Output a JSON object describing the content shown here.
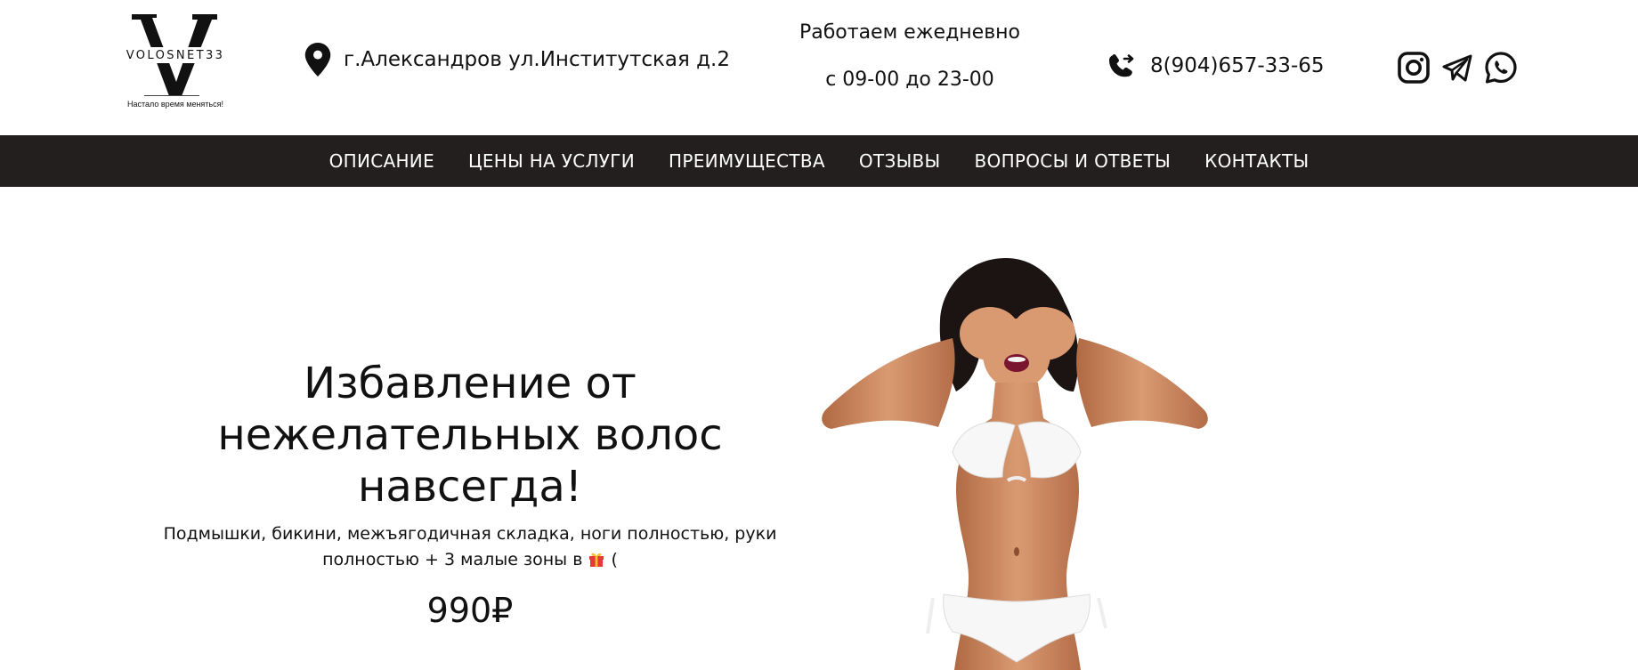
{
  "logo": {
    "brand": "VOLOSNET33",
    "slogan": "Настало время меняться!"
  },
  "header": {
    "address": "г.Александров ул.Институтская д.2",
    "hours_line1": "Работаем ежедневно",
    "hours_line2": "с 09-00 до 23-00",
    "phone": "8(904)657-33-65",
    "icons": {
      "address": "map-pin-icon",
      "phone": "phone-forward-icon",
      "socials": [
        "instagram-icon",
        "telegram-icon",
        "whatsapp-icon"
      ]
    }
  },
  "nav": {
    "items": [
      {
        "label": "ОПИСАНИЕ"
      },
      {
        "label": "ЦЕНЫ НА УСЛУГИ"
      },
      {
        "label": "ПРЕИМУЩЕСТВА"
      },
      {
        "label": "ОТЗЫВЫ"
      },
      {
        "label": "ВОПРОСЫ И ОТВЕТЫ"
      },
      {
        "label": "КОНТАКТЫ"
      }
    ]
  },
  "hero": {
    "title_line1": "Избавление от",
    "title_line2": "нежелательных волос",
    "title_line3": "навсегда!",
    "subtitle_line1": "Подмышки, бикини, межъягодичная складка, ноги полностью, руки",
    "subtitle_line2_a": "полностью + 3 малые зоны в",
    "subtitle_line2_b": "(",
    "price": "990₽"
  },
  "colors": {
    "nav_bg": "#231f1f",
    "nav_text": "#ffffff",
    "text": "#111111",
    "background": "#ffffff"
  }
}
